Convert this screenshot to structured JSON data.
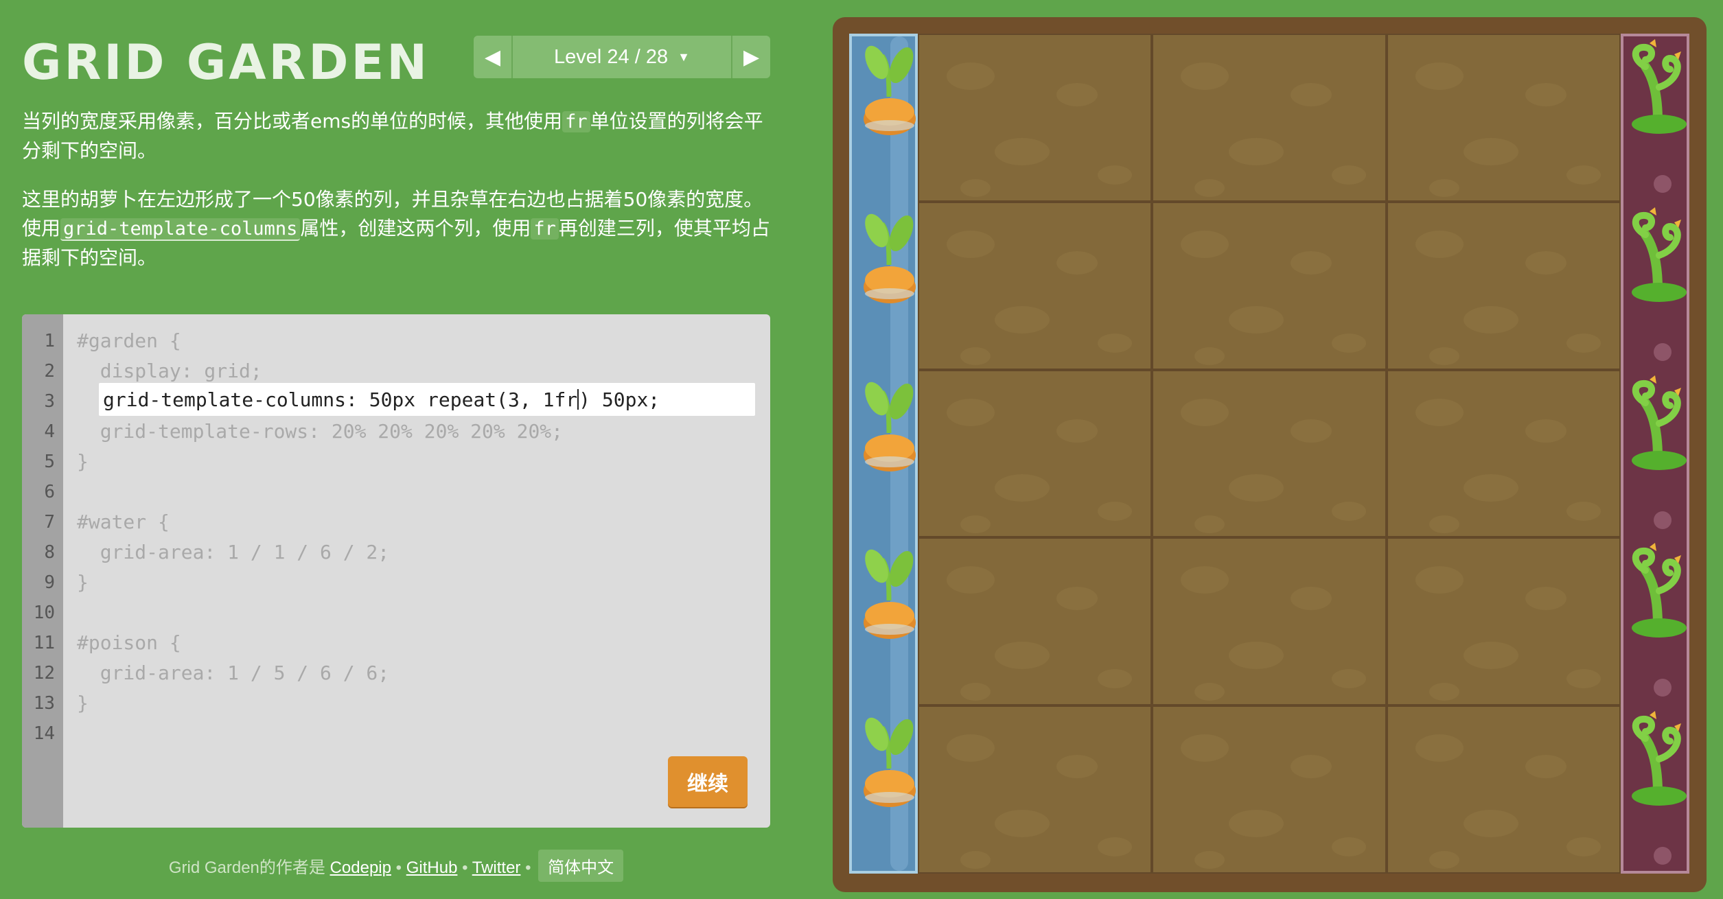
{
  "header": {
    "title": "GRID GARDEN",
    "level_label": "Level 24 / 28"
  },
  "instructions": {
    "p1_a": "当列的宽度采用像素，百分比或者ems的单位的时候，其他使用",
    "p1_code": "fr",
    "p1_b": "单位设置的列将会平分剩下的空间。",
    "p2_a": "这里的胡萝卜在左边形成了一个50像素的列，并且杂草在右边也占据着50像素的宽度。使用",
    "p2_code1": "grid-template-columns",
    "p2_b": "属性，创建这两个列，使用",
    "p2_code2": "fr",
    "p2_c": "再创建三列，使其平均占据剩下的空间。"
  },
  "editor": {
    "line_numbers": [
      "1",
      "2",
      "3",
      "4",
      "5",
      "6",
      "7",
      "8",
      "9",
      "10",
      "11",
      "12",
      "13",
      "14"
    ],
    "lines": {
      "l1": "#garden {",
      "l2": "  display: grid;",
      "l4": "  grid-template-rows: 20% 20% 20% 20% 20%;",
      "l5": "}",
      "l7": "#water {",
      "l8": "  grid-area: 1 / 1 / 6 / 2;",
      "l9": "}",
      "l11": "#poison {",
      "l12": "  grid-area: 1 / 5 / 6 / 6;",
      "l13": "}"
    },
    "input_before_caret": "grid-template-columns: 50px repeat(3, 1fr",
    "input_after_caret": ") 50px;",
    "next_button": "继续"
  },
  "footer": {
    "prefix": "Grid Garden的作者是",
    "link_codepip": "Codepip",
    "sep1": "•",
    "link_github": "GitHub",
    "sep2": "•",
    "link_twitter": "Twitter",
    "sep3": "•",
    "language": "简体中文"
  },
  "garden": {
    "rows": 5,
    "water_color": "#5b8fb7",
    "poison_color": "#6d3446",
    "soil_color": "#83693a",
    "carrot_icon": "carrot-icon",
    "weed_icon": "weed-icon"
  }
}
